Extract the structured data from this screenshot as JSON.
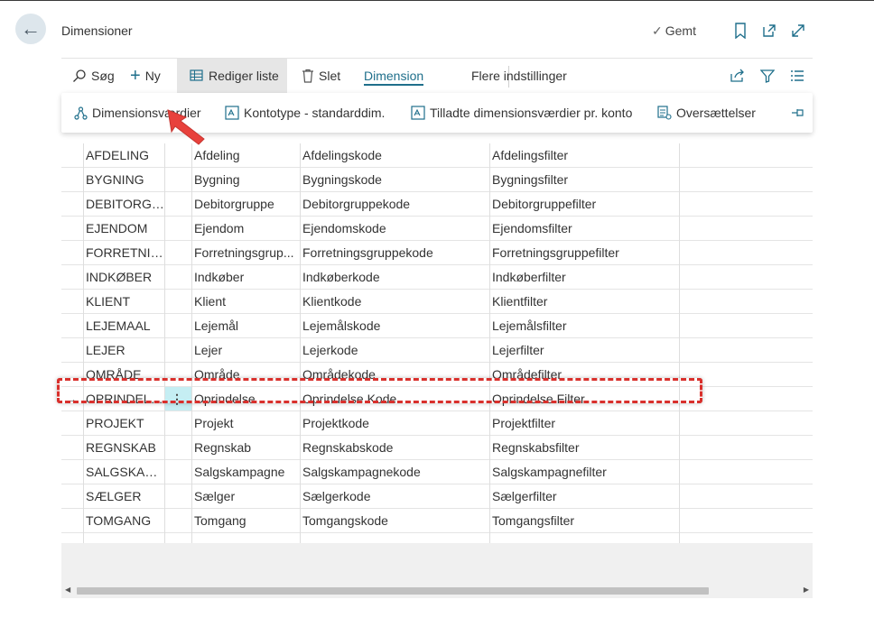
{
  "header": {
    "title": "Dimensioner",
    "saved_label": "Gemt"
  },
  "actions": {
    "search": "Søg",
    "new": "Ny",
    "edit_list": "Rediger liste",
    "delete": "Slet",
    "dimension_tab": "Dimension",
    "more_options": "Flere indstillinger"
  },
  "submenu": {
    "dimension_values": "Dimensionsværdier",
    "account_type_default": "Kontotype - standarddim.",
    "allowed_values": "Tilladte dimensionsværdier pr. konto",
    "translations": "Oversættelser"
  },
  "table": {
    "rows": [
      {
        "code": "AFDELING",
        "name": "Afdeling",
        "code_caption": "Afdelingskode",
        "filter_caption": "Afdelingsfilter"
      },
      {
        "code": "BYGNING",
        "name": "Bygning",
        "code_caption": "Bygningskode",
        "filter_caption": "Bygningsfilter"
      },
      {
        "code": "DEBITORGR...",
        "name": "Debitorgruppe",
        "code_caption": "Debitorgruppekode",
        "filter_caption": "Debitorgruppefilter"
      },
      {
        "code": "EJENDOM",
        "name": "Ejendom",
        "code_caption": "Ejendomskode",
        "filter_caption": "Ejendomsfilter"
      },
      {
        "code": "FORRETNIN...",
        "name": "Forretningsgrup...",
        "code_caption": "Forretningsgruppekode",
        "filter_caption": "Forretningsgruppefilter"
      },
      {
        "code": "INDKØBER",
        "name": "Indkøber",
        "code_caption": "Indkøberkode",
        "filter_caption": "Indkøberfilter"
      },
      {
        "code": "KLIENT",
        "name": "Klient",
        "code_caption": "Klientkode",
        "filter_caption": "Klientfilter"
      },
      {
        "code": "LEJEMAAL",
        "name": "Lejemål",
        "code_caption": "Lejemålskode",
        "filter_caption": "Lejemålsfilter"
      },
      {
        "code": "LEJER",
        "name": "Lejer",
        "code_caption": "Lejerkode",
        "filter_caption": "Lejerfilter"
      },
      {
        "code": "OMRÅDE",
        "name": "Område",
        "code_caption": "Områdekode",
        "filter_caption": "Områdefilter"
      },
      {
        "code": "OPRINDELSE",
        "name": "Oprindelse",
        "code_caption": "Oprindelse Kode",
        "filter_caption": "Oprindelse Filter",
        "selected": true
      },
      {
        "code": "PROJEKT",
        "name": "Projekt",
        "code_caption": "Projektkode",
        "filter_caption": "Projektfilter"
      },
      {
        "code": "REGNSKAB",
        "name": "Regnskab",
        "code_caption": "Regnskabskode",
        "filter_caption": "Regnskabsfilter"
      },
      {
        "code": "SALGSKAM...",
        "name": "Salgskampagne",
        "code_caption": "Salgskampagnekode",
        "filter_caption": "Salgskampagnefilter"
      },
      {
        "code": "SÆLGER",
        "name": "Sælger",
        "code_caption": "Sælgerkode",
        "filter_caption": "Sælgerfilter"
      },
      {
        "code": "TOMGANG",
        "name": "Tomgang",
        "code_caption": "Tomgangskode",
        "filter_caption": "Tomgangsfilter"
      }
    ]
  },
  "colors": {
    "accent": "#1f6f8b",
    "selected_cell": "#c5eef3",
    "annotation": "#d9302c",
    "back_button_bg": "#dde6ec"
  },
  "icons": [
    "back-arrow-icon",
    "check-icon",
    "bookmark-icon",
    "open-new-window-icon",
    "expand-icon",
    "search-icon",
    "plus-icon",
    "edit-list-icon",
    "trash-icon",
    "share-icon",
    "filter-icon",
    "list-view-icon",
    "dimension-values-icon",
    "account-type-icon",
    "allowed-values-icon",
    "translations-icon",
    "pin-icon"
  ]
}
